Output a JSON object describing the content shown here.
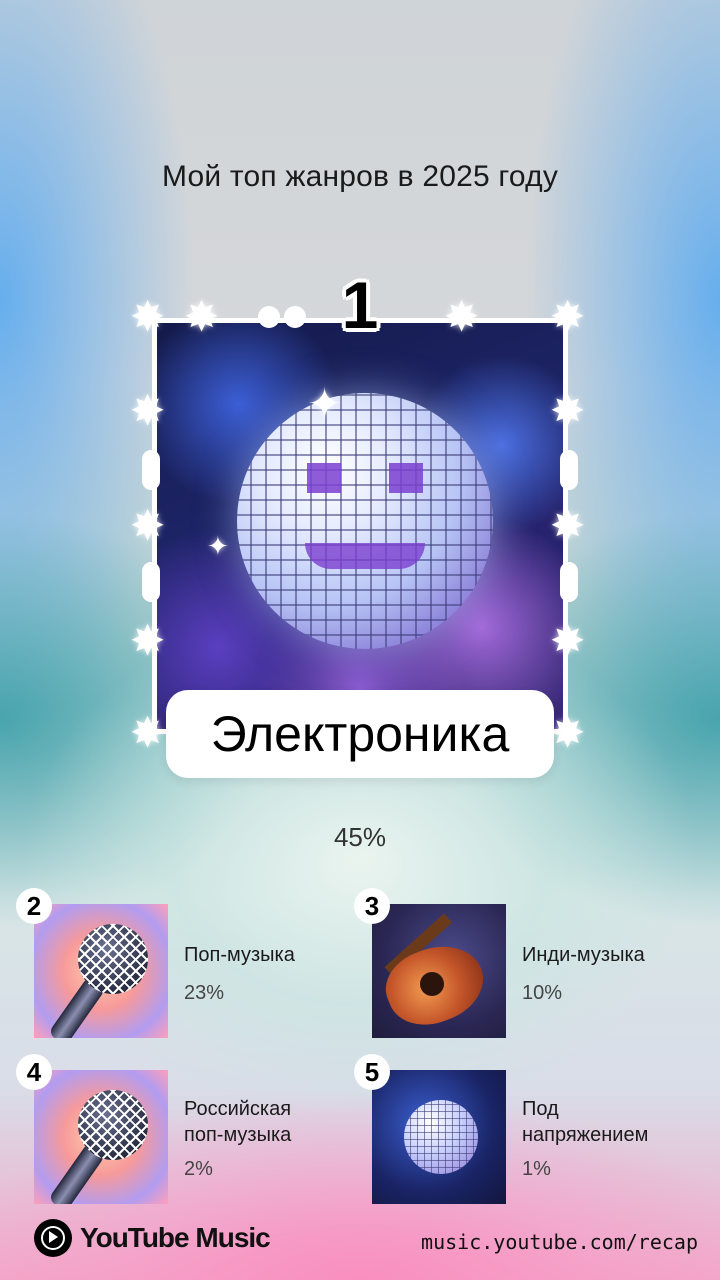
{
  "header": {
    "title": "Мой топ жанров в 2025 году"
  },
  "top_genre": {
    "rank": "1",
    "name": "Электроника",
    "percent": "45%",
    "image": "disco-ball-art"
  },
  "genres": [
    {
      "rank": "2",
      "name": "Поп-музыка",
      "percent": "23%",
      "image": "microphone-art"
    },
    {
      "rank": "3",
      "name": "Инди-музыка",
      "percent": "10%",
      "image": "guitar-art"
    },
    {
      "rank": "4",
      "name": "Российская поп-музыка",
      "percent": "2%",
      "image": "microphone-art"
    },
    {
      "rank": "5",
      "name": "Под напряжением",
      "percent": "1%",
      "image": "disco-ball-art"
    }
  ],
  "footer": {
    "brand": "YouTube Music",
    "url": "music.youtube.com/recap"
  },
  "colors": {
    "text": "#111111",
    "card_border": "#ffffff",
    "label_bg": "#ffffff"
  }
}
